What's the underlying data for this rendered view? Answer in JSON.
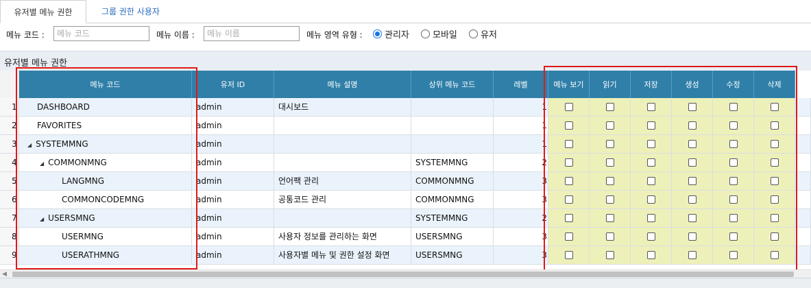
{
  "tabs": [
    {
      "label": "유저별 메뉴 권한",
      "active": true
    },
    {
      "label": "그룹 권한 사용자",
      "active": false
    }
  ],
  "filters": {
    "menu_code_label": "메뉴 코드 :",
    "menu_code_placeholder": "메뉴 코드",
    "menu_name_label": "메뉴 이름 :",
    "menu_name_placeholder": "메뉴 이름",
    "menu_area_label": "메뉴 영역 유형 :",
    "radios": [
      {
        "label": "관리자",
        "selected": true
      },
      {
        "label": "모바일",
        "selected": false
      },
      {
        "label": "유저",
        "selected": false
      }
    ]
  },
  "section_title": "유저별 메뉴 권한",
  "grid": {
    "columns": [
      "메뉴 코드",
      "유저 ID",
      "메뉴 설명",
      "상위 메뉴 코드",
      "레벨",
      "메뉴 보기",
      "읽기",
      "저장",
      "생성",
      "수정",
      "삭제"
    ],
    "rows": [
      {
        "num": "1",
        "code": "DASHBOARD",
        "depth": 0,
        "expander": false,
        "user": "admin",
        "desc": "대시보드",
        "parent": "",
        "level": "1"
      },
      {
        "num": "2",
        "code": "FAVORITES",
        "depth": 0,
        "expander": false,
        "user": "admin",
        "desc": "",
        "parent": "",
        "level": "1"
      },
      {
        "num": "3",
        "code": "SYSTEMMNG",
        "depth": 0,
        "expander": true,
        "user": "admin",
        "desc": "",
        "parent": "",
        "level": "1"
      },
      {
        "num": "4",
        "code": "COMMONMNG",
        "depth": 1,
        "expander": true,
        "user": "admin",
        "desc": "",
        "parent": "SYSTEMMNG",
        "level": "2"
      },
      {
        "num": "5",
        "code": "LANGMNG",
        "depth": 2,
        "expander": false,
        "user": "admin",
        "desc": "언어팩 관리",
        "parent": "COMMONMNG",
        "level": "3"
      },
      {
        "num": "6",
        "code": "COMMONCODEMNG",
        "depth": 2,
        "expander": false,
        "user": "admin",
        "desc": "공통코드 관리",
        "parent": "COMMONMNG",
        "level": "3"
      },
      {
        "num": "7",
        "code": "USERSMNG",
        "depth": 1,
        "expander": true,
        "user": "admin",
        "desc": "",
        "parent": "SYSTEMMNG",
        "level": "2"
      },
      {
        "num": "8",
        "code": "USERMNG",
        "depth": 2,
        "expander": false,
        "user": "admin",
        "desc": "사용자 정보를 관리하는 화면",
        "parent": "USERSMNG",
        "level": "3"
      },
      {
        "num": "9",
        "code": "USERATHMNG",
        "depth": 2,
        "expander": false,
        "user": "admin",
        "desc": "사용자별 메뉴 및 권한 설정 화면",
        "parent": "USERSMNG",
        "level": "3"
      }
    ]
  },
  "icons": {
    "expander": "triangle-down-icon",
    "scroll_left": "arrow-left-icon"
  },
  "colors": {
    "header_bg": "#2f7fa8",
    "checkbox_bg": "#eef0b9",
    "highlight": "#e01818",
    "tab_link": "#2a6bbf"
  }
}
